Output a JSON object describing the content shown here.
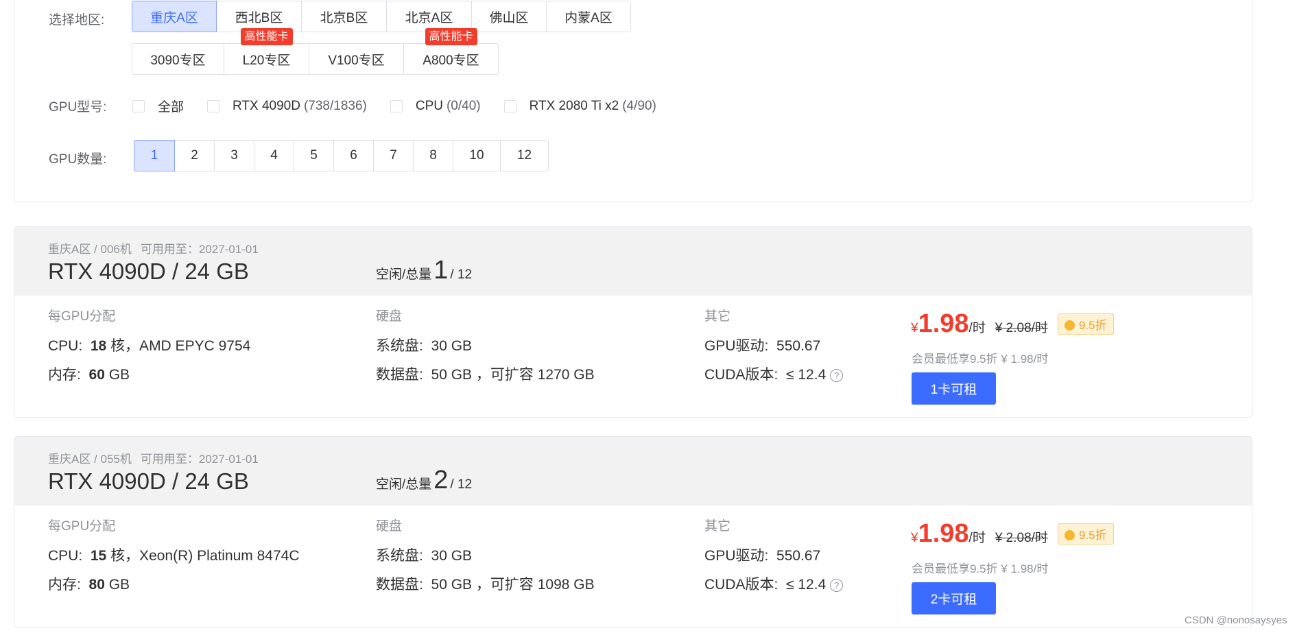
{
  "filters": {
    "region_label": "选择地区:",
    "regions_row1": [
      {
        "label": "重庆A区",
        "active": true,
        "tag": ""
      },
      {
        "label": "西北B区",
        "active": false,
        "tag": ""
      },
      {
        "label": "北京B区",
        "active": false,
        "tag": ""
      },
      {
        "label": "北京A区",
        "active": false,
        "tag": ""
      },
      {
        "label": "佛山区",
        "active": false,
        "tag": ""
      },
      {
        "label": "内蒙A区",
        "active": false,
        "tag": ""
      }
    ],
    "regions_row2": [
      {
        "label": "3090专区",
        "tag": ""
      },
      {
        "label": "L20专区",
        "tag": "高性能卡"
      },
      {
        "label": "V100专区",
        "tag": ""
      },
      {
        "label": "A800专区",
        "tag": "高性能卡"
      }
    ],
    "gpu_model_label": "GPU型号:",
    "gpu_models": [
      {
        "label": "全部",
        "count": ""
      },
      {
        "label": "RTX 4090D",
        "count": "(738/1836)"
      },
      {
        "label": "CPU",
        "count": "(0/40)"
      },
      {
        "label": "RTX 2080 Ti x2",
        "count": "(4/90)"
      }
    ],
    "gpu_count_label": "GPU数量:",
    "gpu_counts": [
      "1",
      "2",
      "3",
      "4",
      "5",
      "6",
      "7",
      "8",
      "10",
      "12"
    ],
    "gpu_count_selected": "1"
  },
  "machines": [
    {
      "region_machine": "重庆A区 / 006机",
      "available_until": "可用用至：2027-01-01",
      "title": "RTX 4090D / 24 GB",
      "avail_label": "空闲/总量",
      "avail_free": "1",
      "avail_total": "/ 12",
      "alloc_header": "每GPU分配",
      "cpu_label": "CPU:",
      "cpu_cores": "18",
      "cpu_detail": "核，AMD EPYC 9754",
      "mem_label": "内存:",
      "mem_value": "60",
      "mem_unit": "GB",
      "disk_header": "硬盘",
      "sys_disk_label": "系统盘:",
      "sys_disk_value": "30 GB",
      "data_disk_label": "数据盘:",
      "data_disk_value": "50 GB ，可扩容 1270 GB",
      "other_header": "其它",
      "driver_label": "GPU驱动:",
      "driver_value": "550.67",
      "cuda_label": "CUDA版本:",
      "cuda_value": "≤ 12.4",
      "price_currency": "¥",
      "price_value": "1.98",
      "price_unit": "/时",
      "price_old": "¥ 2.08/时",
      "discount": "9.5折",
      "member_note": "会员最低享9.5折 ¥ 1.98/时",
      "rent_label": "1卡可租"
    },
    {
      "region_machine": "重庆A区 / 055机",
      "available_until": "可用用至：2027-01-01",
      "title": "RTX 4090D / 24 GB",
      "avail_label": "空闲/总量",
      "avail_free": "2",
      "avail_total": "/ 12",
      "alloc_header": "每GPU分配",
      "cpu_label": "CPU:",
      "cpu_cores": "15",
      "cpu_detail": "核，Xeon(R) Platinum 8474C",
      "mem_label": "内存:",
      "mem_value": "80",
      "mem_unit": "GB",
      "disk_header": "硬盘",
      "sys_disk_label": "系统盘:",
      "sys_disk_value": "30 GB",
      "data_disk_label": "数据盘:",
      "data_disk_value": "50 GB ，可扩容 1098 GB",
      "other_header": "其它",
      "driver_label": "GPU驱动:",
      "driver_value": "550.67",
      "cuda_label": "CUDA版本:",
      "cuda_value": "≤ 12.4",
      "price_currency": "¥",
      "price_value": "1.98",
      "price_unit": "/时",
      "price_old": "¥ 2.08/时",
      "discount": "9.5折",
      "member_note": "会员最低享9.5折 ¥ 1.98/时",
      "rent_label": "2卡可租"
    }
  ],
  "watermark": "CSDN @nonosaysyes",
  "colors": {
    "accent": "#3b6bff",
    "price_red": "#f23d2d",
    "discount_bg": "#fdf2d4",
    "header_bg": "#f2f2f2"
  }
}
